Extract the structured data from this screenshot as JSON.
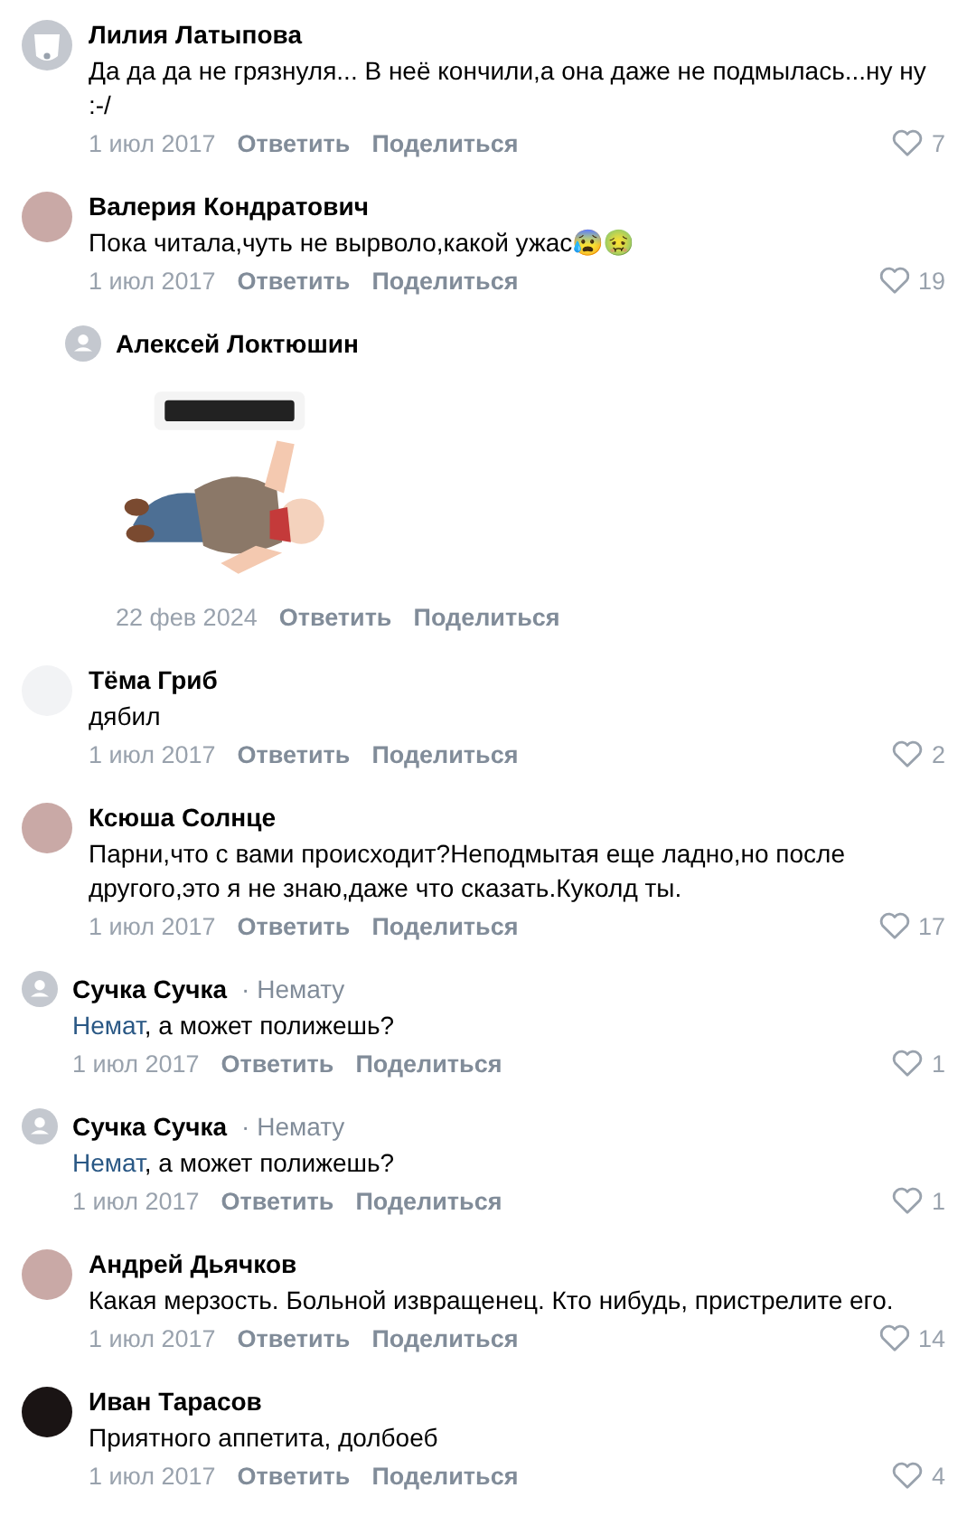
{
  "comments": [
    {
      "kind": "comment",
      "avatar": {
        "kind": "dog"
      },
      "author": "Лилия Латыпова",
      "text": "Да да да не грязнуля... В неё кончили,а она даже не подмылась...ну ну :-/",
      "date": "1 июл 2017",
      "reply": "Ответить",
      "share": "Поделиться",
      "likes": "7"
    },
    {
      "kind": "comment",
      "author": "Валерия Кондратович",
      "text": "Пока читала,чуть не вырволо,какой ужас😰🤢",
      "date": "1 июл 2017",
      "reply": "Ответить",
      "share": "Поделиться",
      "likes": "19"
    },
    {
      "kind": "sticker",
      "avatar": {
        "kind": "placeholder"
      },
      "author": "Алексей Локтюшин",
      "date": "22 фев 2024",
      "reply": "Ответить",
      "share": "Поделиться"
    },
    {
      "kind": "comment",
      "avatar": {
        "kind": "logo"
      },
      "author": "Тёма Гриб",
      "text": "дябил",
      "date": "1 июл 2017",
      "reply": "Ответить",
      "share": "Поделиться",
      "likes": "2"
    },
    {
      "kind": "comment",
      "author": "Ксюша Солнце",
      "text": "Парни,что с вами происходит?Неподмытая еще ладно,но после другого,это я не знаю,даже что сказать.Куколд ты.",
      "date": "1 июл 2017",
      "reply": "Ответить",
      "share": "Поделиться",
      "likes": "17"
    },
    {
      "kind": "reply",
      "avatar": {
        "kind": "placeholder"
      },
      "author": "Сучка Сучка",
      "to": "· Немату",
      "mention": "Немат",
      "text": ", а может полижешь?",
      "date": "1 июл 2017",
      "reply": "Ответить",
      "share": "Поделиться",
      "likes": "1"
    },
    {
      "kind": "reply",
      "avatar": {
        "kind": "placeholder"
      },
      "author": "Сучка Сучка",
      "to": "· Немату",
      "mention": "Немат",
      "text": ", а может полижешь?",
      "date": "1 июл 2017",
      "reply": "Ответить",
      "share": "Поделиться",
      "likes": "1"
    },
    {
      "kind": "comment",
      "author": "Андрей Дьячков",
      "text": "Какая мерзость. Больной извращенец. Кто нибудь, пристрелите его.",
      "date": "1 июл 2017",
      "reply": "Ответить",
      "share": "Поделиться",
      "likes": "14"
    },
    {
      "kind": "comment",
      "avatar": {
        "kind": "dark"
      },
      "author": "Иван Тарасов",
      "text": "Приятного аппетита, долбоеб",
      "date": "1 июл 2017",
      "reply": "Ответить",
      "share": "Поделиться",
      "likes": "4"
    }
  ]
}
